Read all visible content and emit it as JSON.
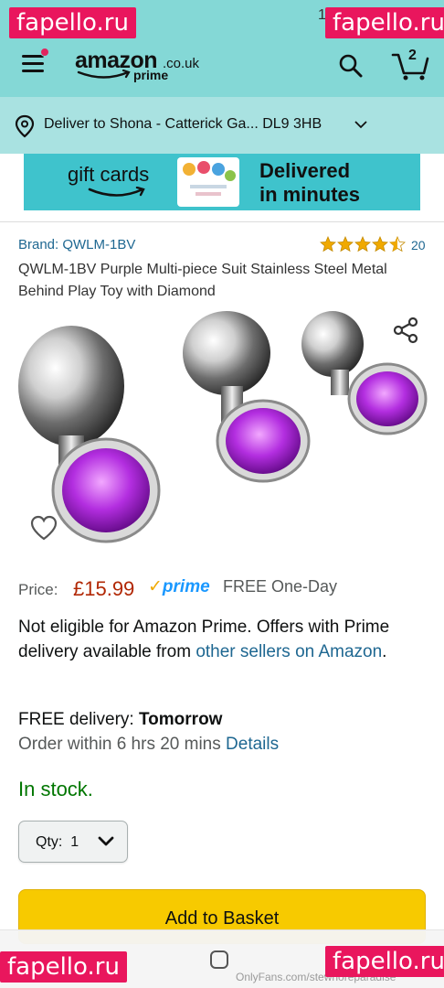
{
  "watermarks": {
    "top_left": "fapello.ru",
    "top_right": "fapello.ru",
    "bottom_left": "fapello.ru",
    "bottom_right": "fapello.ru"
  },
  "status_bar": {
    "left": "• •",
    "right": "1"
  },
  "header": {
    "logo_word": "amazon",
    "logo_domain": ".co.uk",
    "logo_prime": "prime",
    "cart_count": "2"
  },
  "deliver": {
    "text": "Deliver to Shona - Catterick Ga... DL9 3HB"
  },
  "banner": {
    "left_text": "gift cards",
    "right_line1": "Delivered",
    "right_line2": "in minutes"
  },
  "product": {
    "brand": "Brand: QWLM-1BV",
    "rating": 4.5,
    "review_count": "20",
    "title": "QWLM-1BV Purple Multi-piece Suit Stainless Steel Metal Behind Play Toy with Diamond"
  },
  "price": {
    "label": "Price:",
    "value": "£15.99",
    "prime_check": "✓",
    "prime_label": "prime",
    "free_one_day": "FREE One-Day"
  },
  "eligibility": {
    "text": "Not eligible for Amazon Prime. Offers with Prime delivery available from ",
    "link": "other sellers on Amazon",
    "tail": "."
  },
  "delivery": {
    "prefix": "FREE delivery: ",
    "day": "Tomorrow",
    "order_within": "Order within 6 hrs 20 mins ",
    "details_link": "Details"
  },
  "stock": {
    "text": "In stock."
  },
  "quantity": {
    "label": "Qty:",
    "value": "1"
  },
  "basket": {
    "label": "Add to Basket"
  },
  "nav": {
    "credit": "OnlyFans.com/stewhoreparadise"
  },
  "colors": {
    "header_bg": "#84d8d6",
    "deliver_bg": "#a9e2e1",
    "link": "#1e6791",
    "price": "#b12704",
    "in_stock": "#007600",
    "basket_button": "#f7ca00",
    "star": "#f0a900",
    "prime_blue": "#1a98ff"
  },
  "icons": [
    "menu-icon",
    "search-icon",
    "cart-icon",
    "location-pin-icon",
    "chevron-down-icon",
    "share-icon",
    "heart-icon",
    "star-icon",
    "home-icon"
  ]
}
